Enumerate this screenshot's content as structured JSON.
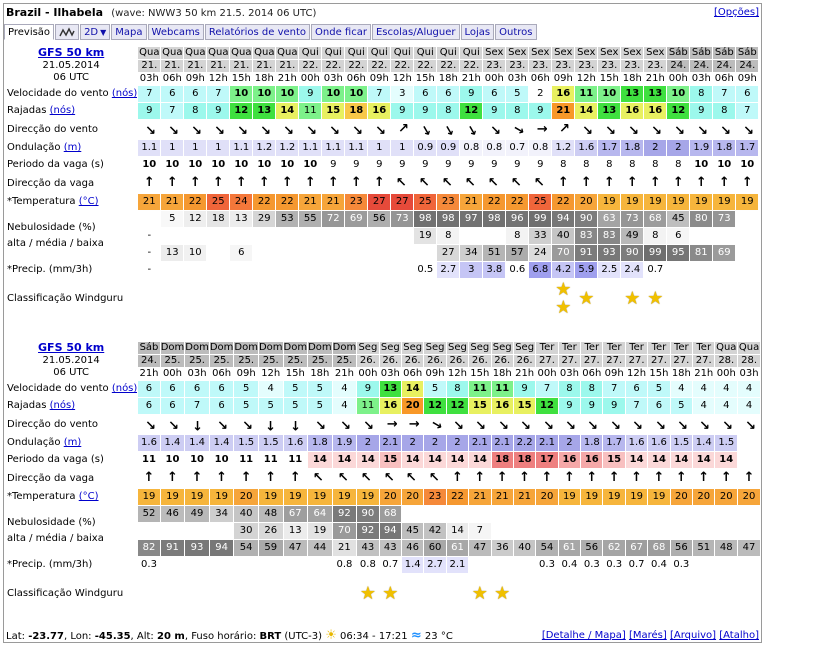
{
  "header": {
    "spot": "Brazil - Ilhabela",
    "wave_info": "(wave: NWW3 50 km 21.5. 2014 06 UTC)",
    "options": "[Opções]"
  },
  "tabs": {
    "previsao": "Previsão",
    "twod": "2D",
    "mapa": "Mapa",
    "webcams": "Webcams",
    "relatorios": "Relatórios de vento",
    "onde_ficar": "Onde ficar",
    "escolas": "Escolas/Aluguer",
    "lojas": "Lojas",
    "outros": "Outros"
  },
  "labels": {
    "wind": "Velocidade do vento",
    "wind_unit": "(nós)",
    "gust": "Rajadas",
    "gust_unit": "(nós)",
    "wind_dir": "Direcção do vento",
    "wave": "Ondulação",
    "wave_unit": "(m)",
    "period": "Periodo da vaga (s)",
    "wave_dir": "Direcção da vaga",
    "temp": "*Temperatura",
    "temp_unit": "(°C)",
    "cloud1": "Nebulosidade (%)",
    "cloud2": "alta / média / baixa",
    "precip": "*Precip. (mm/3h)",
    "rating": "Classificação Windguru"
  },
  "colors": {
    "gray_header": "#d4d4d4",
    "weekend_header": "#bcbcbc",
    "link": "#0000cc",
    "star": "#f0c000"
  },
  "blocks": [
    {
      "model": "GFS 50 km",
      "date": "21.05.2014",
      "utc": "06 UTC",
      "days": [
        "Qua",
        "Qua",
        "Qua",
        "Qua",
        "Qua",
        "Qua",
        "Qua",
        "Qui",
        "Qui",
        "Qui",
        "Qui",
        "Qui",
        "Qui",
        "Qui",
        "Qui",
        "Sex",
        "Sex",
        "Sex",
        "Sex",
        "Sex",
        "Sex",
        "Sex",
        "Sex",
        "Sáb",
        "Sáb",
        "Sáb",
        "Sáb",
        "Sáb"
      ],
      "dates": [
        "21.",
        "21.",
        "21.",
        "21.",
        "21.",
        "21.",
        "21.",
        "22.",
        "22.",
        "22.",
        "22.",
        "22.",
        "22.",
        "22.",
        "22.",
        "23.",
        "23.",
        "23.",
        "23.",
        "23.",
        "23.",
        "23.",
        "23.",
        "24.",
        "24.",
        "24.",
        "24.",
        "24."
      ],
      "hours": [
        "03h",
        "06h",
        "09h",
        "12h",
        "15h",
        "18h",
        "21h",
        "00h",
        "03h",
        "06h",
        "09h",
        "12h",
        "15h",
        "18h",
        "21h",
        "00h",
        "03h",
        "06h",
        "09h",
        "12h",
        "15h",
        "18h",
        "21h",
        "00h",
        "03h",
        "06h",
        "09h",
        "12h"
      ],
      "wind": [
        "7",
        "6",
        "6",
        "7",
        "10",
        "10",
        "10",
        "9",
        "10",
        "10",
        "7",
        "3",
        "6",
        "6",
        "9",
        "6",
        "5",
        "2",
        "16",
        "11",
        "10",
        "13",
        "13",
        "10",
        "8",
        "7",
        "6"
      ],
      "gust": [
        "9",
        "7",
        "8",
        "9",
        "12",
        "13",
        "14",
        "11",
        "15",
        "18",
        "16",
        "9",
        "9",
        "8",
        "12",
        "9",
        "8",
        "9",
        "21",
        "14",
        "13",
        "16",
        "16",
        "12",
        "9",
        "8",
        "7"
      ],
      "wind_dir": [
        315,
        315,
        315,
        315,
        315,
        315,
        315,
        315,
        315,
        315,
        315,
        225,
        330,
        330,
        330,
        315,
        300,
        270,
        225,
        315,
        315,
        315,
        315,
        315,
        315,
        315,
        315,
        315
      ],
      "wave": [
        "1.1",
        "1",
        "1",
        "1",
        "1.1",
        "1.2",
        "1.2",
        "1.1",
        "1.1",
        "1.1",
        "1",
        "1",
        "0.9",
        "0.9",
        "0.8",
        "0.8",
        "0.7",
        "0.8",
        "1.2",
        "1.6",
        "1.7",
        "1.8",
        "2",
        "2",
        "1.9",
        "1.8",
        "1.7"
      ],
      "period": [
        "10",
        "10",
        "10",
        "10",
        "10",
        "10",
        "10",
        "10",
        "9",
        "9",
        "9",
        "9",
        "9",
        "9",
        "9",
        "9",
        "9",
        "9",
        "8",
        "8",
        "8",
        "8",
        "8",
        "8",
        "10",
        "10",
        "10"
      ],
      "wave_dir": [
        0,
        0,
        0,
        0,
        0,
        0,
        0,
        0,
        0,
        0,
        0,
        315,
        315,
        315,
        315,
        315,
        315,
        315,
        0,
        0,
        0,
        0,
        0,
        0,
        0,
        0,
        0,
        0
      ],
      "temp": [
        "21",
        "21",
        "22",
        "25",
        "24",
        "22",
        "22",
        "21",
        "21",
        "23",
        "27",
        "27",
        "25",
        "23",
        "21",
        "22",
        "22",
        "25",
        "22",
        "20",
        "19",
        "19",
        "19",
        "19",
        "19",
        "19",
        "19"
      ],
      "cloud_high": [
        "",
        "5",
        "12",
        "18",
        "13",
        "29",
        "53",
        "55",
        "72",
        "69",
        "56",
        "73",
        "98",
        "98",
        "97",
        "98",
        "96",
        "99",
        "94",
        "90",
        "63",
        "73",
        "68",
        "45",
        "80",
        "73",
        ""
      ],
      "cloud_mid": [
        "-",
        "",
        "",
        "",
        "",
        "",
        "",
        "",
        "",
        "",
        "",
        "",
        "19",
        "8",
        "",
        "",
        "8",
        "33",
        "40",
        "83",
        "83",
        "49",
        "8",
        "6",
        "",
        "",
        ""
      ],
      "cloud_low": [
        "-",
        "13",
        "10",
        "",
        "6",
        "",
        "",
        "",
        "",
        "",
        "",
        "",
        "",
        "27",
        "34",
        "51",
        "57",
        "24",
        "70",
        "91",
        "93",
        "90",
        "99",
        "95",
        "81",
        "69",
        ""
      ],
      "precip": [
        "-",
        "",
        "",
        "",
        "",
        "",
        "",
        "",
        "",
        "",
        "",
        "",
        "0.5",
        "2.7",
        "3",
        "3.8",
        "0.6",
        "6.8",
        "4.2",
        "5.9",
        "2.5",
        "2.4",
        "0.7",
        "",
        "",
        "",
        ""
      ],
      "rating": [
        "",
        "",
        "",
        "",
        "",
        "",
        "",
        "",
        "",
        "",
        "",
        "",
        "",
        "",
        "",
        "",
        "",
        "",
        "2",
        "1",
        "",
        "1",
        "1",
        "",
        "",
        "",
        ""
      ]
    },
    {
      "model": "GFS 50 km",
      "date": "21.05.2014",
      "utc": "06 UTC",
      "days": [
        "Sáb",
        "Dom",
        "Dom",
        "Dom",
        "Dom",
        "Dom",
        "Dom",
        "Dom",
        "Dom",
        "Seg",
        "Seg",
        "Seg",
        "Seg",
        "Seg",
        "Seg",
        "Seg",
        "Seg",
        "Ter",
        "Ter",
        "Ter",
        "Ter",
        "Ter",
        "Ter",
        "Ter",
        "Ter",
        "Qua",
        "Qua",
        "Qua"
      ],
      "dates": [
        "24.",
        "25.",
        "25.",
        "25.",
        "25.",
        "25.",
        "25.",
        "25.",
        "25.",
        "26.",
        "26.",
        "26.",
        "26.",
        "26.",
        "26.",
        "26.",
        "26.",
        "27.",
        "27.",
        "27.",
        "27.",
        "27.",
        "27.",
        "27.",
        "27.",
        "28.",
        "28.",
        "28."
      ],
      "hours": [
        "21h",
        "00h",
        "03h",
        "06h",
        "09h",
        "12h",
        "15h",
        "18h",
        "21h",
        "00h",
        "03h",
        "06h",
        "09h",
        "12h",
        "15h",
        "18h",
        "21h",
        "00h",
        "03h",
        "06h",
        "09h",
        "12h",
        "15h",
        "18h",
        "21h",
        "00h",
        "03h",
        "06h"
      ],
      "wind": [
        "6",
        "6",
        "6",
        "6",
        "5",
        "4",
        "5",
        "5",
        "4",
        "9",
        "13",
        "14",
        "5",
        "8",
        "11",
        "11",
        "9",
        "7",
        "8",
        "8",
        "7",
        "6",
        "5",
        "4",
        "4",
        "4",
        "4"
      ],
      "gust": [
        "6",
        "6",
        "7",
        "6",
        "5",
        "5",
        "5",
        "5",
        "4",
        "11",
        "16",
        "20",
        "12",
        "12",
        "15",
        "16",
        "15",
        "12",
        "9",
        "9",
        "9",
        "7",
        "6",
        "5",
        "4",
        "4",
        "4"
      ],
      "wind_dir": [
        315,
        315,
        0,
        315,
        315,
        0,
        0,
        315,
        315,
        315,
        270,
        270,
        300,
        315,
        315,
        315,
        315,
        315,
        315,
        315,
        315,
        315,
        315,
        315,
        315,
        315,
        315,
        315
      ],
      "wave": [
        "1.6",
        "1.4",
        "1.4",
        "1.4",
        "1.5",
        "1.5",
        "1.6",
        "1.8",
        "1.9",
        "2",
        "2.1",
        "2",
        "2",
        "2",
        "2.1",
        "2.1",
        "2.2",
        "2.1",
        "2",
        "1.8",
        "1.7",
        "1.6",
        "1.6",
        "1.5",
        "1.4",
        "1.5",
        ""
      ],
      "period": [
        "11",
        "10",
        "10",
        "10",
        "11",
        "11",
        "11",
        "14",
        "14",
        "14",
        "15",
        "14",
        "14",
        "14",
        "14",
        "18",
        "18",
        "17",
        "16",
        "16",
        "15",
        "14",
        "14",
        "14",
        "14",
        "14",
        ""
      ],
      "wave_dir": [
        0,
        0,
        0,
        0,
        0,
        0,
        0,
        315,
        315,
        315,
        315,
        315,
        315,
        0,
        0,
        0,
        0,
        0,
        0,
        0,
        0,
        0,
        0,
        0,
        0,
        0,
        0,
        0
      ],
      "temp": [
        "19",
        "19",
        "19",
        "19",
        "20",
        "19",
        "19",
        "19",
        "19",
        "19",
        "20",
        "20",
        "23",
        "22",
        "21",
        "21",
        "21",
        "20",
        "19",
        "19",
        "19",
        "19",
        "19",
        "20",
        "20",
        "20",
        "20"
      ],
      "cloud_high": [
        "52",
        "46",
        "49",
        "34",
        "40",
        "48",
        "67",
        "64",
        "92",
        "90",
        "68",
        "",
        "",
        "",
        "",
        "",
        "",
        "",
        "",
        "",
        "",
        "",
        "",
        "",
        "",
        "",
        ""
      ],
      "cloud_mid": [
        "",
        "",
        "",
        "",
        "30",
        "26",
        "13",
        "19",
        "70",
        "92",
        "94",
        "45",
        "42",
        "14",
        "7",
        "",
        "",
        "",
        "",
        "",
        "",
        "",
        "",
        "",
        "",
        "",
        ""
      ],
      "cloud_low": [
        "82",
        "91",
        "93",
        "94",
        "54",
        "59",
        "47",
        "44",
        "21",
        "43",
        "43",
        "46",
        "60",
        "61",
        "47",
        "36",
        "40",
        "54",
        "61",
        "56",
        "62",
        "67",
        "68",
        "56",
        "51",
        "48",
        "47"
      ],
      "precip": [
        "0.3",
        "",
        "",
        "",
        "",
        "",
        "",
        "",
        "0.8",
        "0.8",
        "0.7",
        "1.4",
        "2.7",
        "2.1",
        "",
        "",
        "",
        "0.3",
        "0.4",
        "0.3",
        "0.3",
        "0.7",
        "0.4",
        "0.3",
        "",
        "",
        ""
      ],
      "rating": [
        "",
        "",
        "",
        "",
        "",
        "",
        "",
        "",
        "",
        "1",
        "1",
        "",
        "",
        "",
        "1",
        "1",
        "",
        "",
        "",
        "",
        "",
        "",
        "",
        "",
        "",
        "",
        ""
      ]
    }
  ],
  "footer": {
    "lat_label": "Lat:",
    "lat": "-23.77",
    "lon_label": "Lon:",
    "lon": "-45.35",
    "alt_label": "Alt:",
    "alt": "20 m",
    "tz_label": "Fuso horário:",
    "tz": "BRT",
    "utc_offset": "(UTC-3)",
    "sun": "06:34 - 17:21",
    "water_temp": "23 °C",
    "links": [
      "[Detalhe / Mapa]",
      "[Marés]",
      "[Arquivo]",
      "[Atalho]"
    ]
  }
}
